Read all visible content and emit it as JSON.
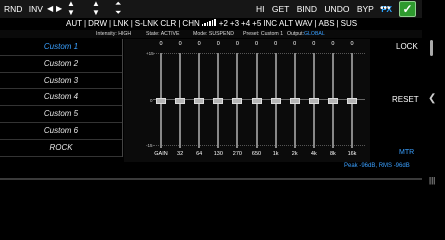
{
  "toolbar": {
    "rnd": "RND",
    "inv": "INV",
    "hi": "HI",
    "get": "GET",
    "bind": "BIND",
    "undo": "UNDO",
    "byp": "BYP",
    "fx": "FX",
    "more": "•••",
    "confirm": "✓"
  },
  "row2": {
    "items": [
      "AUT",
      "|",
      "DRW",
      "|",
      "LNK",
      "|",
      "S-LNK",
      "CLR",
      "|",
      "CHN"
    ],
    "items_b": [
      "+2",
      "+3",
      "+4",
      "+5",
      "INC",
      "ALT",
      "WAV",
      "|",
      "ABS",
      "|",
      "SUS"
    ]
  },
  "status": {
    "intensity": "Intensity: HIGH",
    "state": "State: ACTIVE",
    "mode": "Mode: SUSPEND",
    "preset": "Preset: Custom 1",
    "output_label": "Output:",
    "output_value": "GLOBAL"
  },
  "presets": [
    "Custom 1",
    "Custom 2",
    "Custom 3",
    "Custom 4",
    "Custom 5",
    "Custom 6",
    "ROCK"
  ],
  "active_preset_index": 0,
  "scale": {
    "top": "+15",
    "mid": "0",
    "bottom": "-15"
  },
  "bands": [
    {
      "freq": "GAIN",
      "value": "0"
    },
    {
      "freq": "32",
      "value": "0"
    },
    {
      "freq": "64",
      "value": "0"
    },
    {
      "freq": "130",
      "value": "0"
    },
    {
      "freq": "270",
      "value": "0"
    },
    {
      "freq": "650",
      "value": "0"
    },
    {
      "freq": "1k",
      "value": "0"
    },
    {
      "freq": "2k",
      "value": "0"
    },
    {
      "freq": "4k",
      "value": "0"
    },
    {
      "freq": "8k",
      "value": "0"
    },
    {
      "freq": "16k",
      "value": "0"
    }
  ],
  "right": {
    "lock": "LOCK",
    "reset": "RESET",
    "mtr": "MTR"
  },
  "meter": {
    "peak": "Peak -96dB, RMS -96dB"
  },
  "colors": {
    "accent": "#3aa0ff",
    "confirm": "#2e9a2e"
  }
}
